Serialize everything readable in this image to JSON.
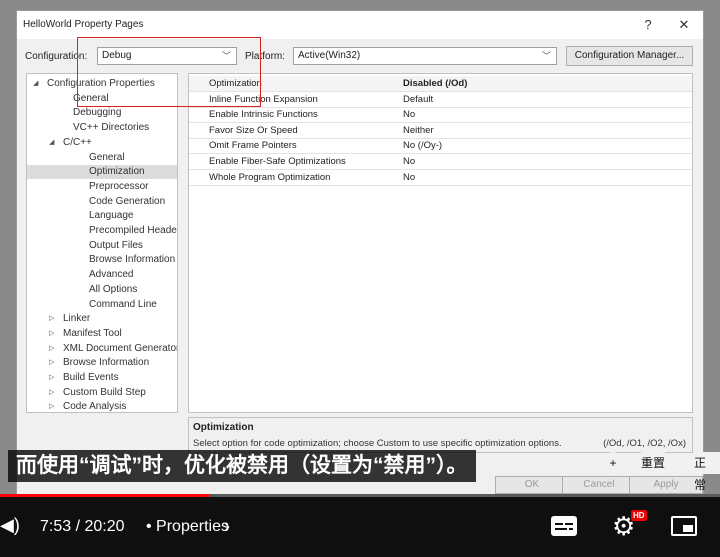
{
  "dialog": {
    "title": "HelloWorld Property Pages",
    "help_label": "?",
    "close_label": "✕",
    "configuration_label": "Configuration:",
    "configuration_value": "Debug",
    "platform_label": "Platform:",
    "platform_value": "Active(Win32)",
    "config_manager_label": "Configuration Manager..."
  },
  "tree": [
    {
      "label": "Configuration Properties",
      "twisty": "◢"
    },
    {
      "label": "General"
    },
    {
      "label": "Debugging"
    },
    {
      "label": "VC++ Directories"
    },
    {
      "label": "C/C++",
      "twisty": "◢"
    },
    {
      "label": "General"
    },
    {
      "label": "Optimization",
      "selected": true
    },
    {
      "label": "Preprocessor"
    },
    {
      "label": "Code Generation"
    },
    {
      "label": "Language"
    },
    {
      "label": "Precompiled Headers"
    },
    {
      "label": "Output Files"
    },
    {
      "label": "Browse Information"
    },
    {
      "label": "Advanced"
    },
    {
      "label": "All Options"
    },
    {
      "label": "Command Line"
    },
    {
      "label": "Linker",
      "twisty": "▷"
    },
    {
      "label": "Manifest Tool",
      "twisty": "▷"
    },
    {
      "label": "XML Document Generator",
      "twisty": "▷"
    },
    {
      "label": "Browse Information",
      "twisty": "▷"
    },
    {
      "label": "Build Events",
      "twisty": "▷"
    },
    {
      "label": "Custom Build Step",
      "twisty": "▷"
    },
    {
      "label": "Code Analysis",
      "twisty": "▷"
    }
  ],
  "properties": [
    {
      "name": "Optimization",
      "value": "Disabled (/Od)"
    },
    {
      "name": "Inline Function Expansion",
      "value": "Default"
    },
    {
      "name": "Enable Intrinsic Functions",
      "value": "No"
    },
    {
      "name": "Favor Size Or Speed",
      "value": "Neither"
    },
    {
      "name": "Omit Frame Pointers",
      "value": "No (/Oy-)"
    },
    {
      "name": "Enable Fiber-Safe Optimizations",
      "value": "No"
    },
    {
      "name": "Whole Program Optimization",
      "value": "No"
    }
  ],
  "description": {
    "title": "Optimization",
    "text": "Select option for code optimization; choose Custom to use specific optimization options.",
    "options": "(/Od, /O1, /O2, /Ox)"
  },
  "buttons": {
    "ok": "OK",
    "cancel": "Cancel",
    "apply": "Apply"
  },
  "subtitle": "而使用“调试”时，优化被禁用（设置为“禁用”）。",
  "chips": {
    "plus": "+",
    "reset": "重置",
    "normal": "正常"
  },
  "player": {
    "time": "7:53 / 20:20",
    "chapter": "• Properties",
    "progress": 0.29,
    "hd_badge": "HD"
  }
}
